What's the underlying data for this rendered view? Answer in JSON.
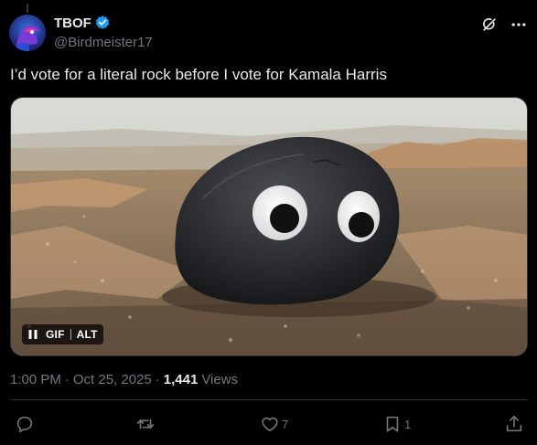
{
  "author": {
    "display_name": "TBOF",
    "handle": "@Birdmeister17"
  },
  "tweet": {
    "text": "I’d vote for a literal rock before I vote for Kamala Harris",
    "time": "1:00 PM",
    "date": "Oct 25, 2025",
    "views_count": "1,441",
    "views_label": "Views"
  },
  "media": {
    "badge_gif": "GIF",
    "badge_alt": "ALT"
  },
  "actions": {
    "reply_count": "",
    "repost_count": "",
    "like_count": "7",
    "bookmark_count": "1"
  },
  "colors": {
    "background": "#000000",
    "text_primary": "#e7e9ea",
    "text_secondary": "#71767b",
    "verified": "#1d9bf0",
    "divider": "#2f3336"
  },
  "icons": {
    "verified": "verified-badge-icon",
    "grok": "grok-icon",
    "more": "more-icon",
    "pause": "pause-icon",
    "reply": "reply-icon",
    "repost": "repost-icon",
    "like": "like-icon",
    "bookmark": "bookmark-icon",
    "share": "share-icon"
  }
}
